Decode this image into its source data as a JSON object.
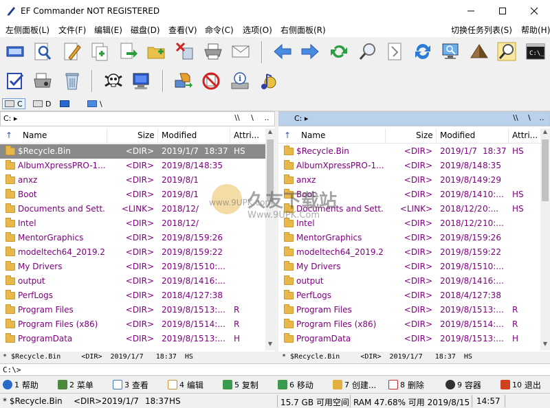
{
  "window": {
    "title": "EF Commander NOT REGISTERED"
  },
  "menu": [
    "左侧面板(L)",
    "文件(F)",
    "编辑(E)",
    "磁盘(D)",
    "查看(V)",
    "命令(C)",
    "选项(O)",
    "右侧面板(R)",
    "切换任务列表(S)",
    "帮助(H)"
  ],
  "toolbar_icons": [
    "drive-icon",
    "find-icon",
    "edit-icon",
    "copy-icon",
    "move-icon",
    "newfolder-icon",
    "delete-icon",
    "print-icon",
    "email-icon",
    "back-icon",
    "forward-icon",
    "refresh-icon",
    "search-icon",
    "compare-icon",
    "sync-icon",
    "monitor-icon",
    "pyramid-icon",
    "zoom-icon",
    "console-icon",
    "select-icon",
    "scanner-icon",
    "recycle-icon",
    "skull-icon",
    "desktop-icon",
    "network-icon",
    "nofile-icon",
    "info-icon",
    "music-icon"
  ],
  "drives": [
    {
      "label": "C"
    },
    {
      "label": "D"
    },
    {
      "label": ""
    },
    {
      "label": "\\"
    }
  ],
  "left": {
    "path": "C: ▸",
    "btn1": "\\\\",
    "btn2": "\\",
    "btn3": "..",
    "headers": {
      "name": "Name",
      "size": "Size",
      "modified": "Modified",
      "attr": "Attri..."
    },
    "rows": [
      {
        "name": "$Recycle.Bin",
        "size": "<DIR>",
        "date": "2019/1/7",
        "time": "18:37",
        "attr": "HS"
      },
      {
        "name": "AlbumXpressPRO-1...",
        "size": "<DIR>",
        "date": "2019/8/14",
        "time": "8:35",
        "attr": ""
      },
      {
        "name": "anxz",
        "size": "<DIR>",
        "date": "2019/8/1",
        "time": "",
        "attr": ""
      },
      {
        "name": "Boot",
        "size": "<DIR>",
        "date": "2019/8/1",
        "time": "",
        "attr": ""
      },
      {
        "name": "Documents and Sett...",
        "size": "<LINK>",
        "date": "2018/12/",
        "time": "",
        "attr": ""
      },
      {
        "name": "Intel",
        "size": "<DIR>",
        "date": "2018/12/",
        "time": "",
        "attr": ""
      },
      {
        "name": "MentorGraphics",
        "size": "<DIR>",
        "date": "2019/8/15",
        "time": "9:26",
        "attr": ""
      },
      {
        "name": "modeltech64_2019.2",
        "size": "<DIR>",
        "date": "2019/8/15",
        "time": "9:22",
        "attr": ""
      },
      {
        "name": "My Drivers",
        "size": "<DIR>",
        "date": "2019/8/15",
        "time": "10:...",
        "attr": ""
      },
      {
        "name": "output",
        "size": "<DIR>",
        "date": "2019/8/14",
        "time": "16:...",
        "attr": ""
      },
      {
        "name": "PerfLogs",
        "size": "<DIR>",
        "date": "2018/4/12",
        "time": "7:38",
        "attr": ""
      },
      {
        "name": "Program Files",
        "size": "<DIR>",
        "date": "2019/8/15",
        "time": "13:...",
        "attr": "R"
      },
      {
        "name": "Program Files (x86)",
        "size": "<DIR>",
        "date": "2019/8/15",
        "time": "14:...",
        "attr": "R"
      },
      {
        "name": "ProgramData",
        "size": "<DIR>",
        "date": "2019/8/15",
        "time": "13:...",
        "attr": "H"
      }
    ],
    "info": "* $Recycle.Bin     <DIR>  2019/1/7   18:37  HS"
  },
  "right": {
    "path": "C: ▸",
    "btn1": "\\\\",
    "btn2": "\\",
    "btn3": "..",
    "headers": {
      "name": "Name",
      "size": "Size",
      "modified": "Modified",
      "attr": "Attri..."
    },
    "rows": [
      {
        "name": "$Recycle.Bin",
        "size": "<DIR>",
        "date": "2019/1/7",
        "time": "18:37",
        "attr": "HS"
      },
      {
        "name": "AlbumXpressPRO-1...",
        "size": "<DIR>",
        "date": "2019/8/14",
        "time": "8:35",
        "attr": ""
      },
      {
        "name": "anxz",
        "size": "<DIR>",
        "date": "2019/8/14",
        "time": "9:29",
        "attr": ""
      },
      {
        "name": "Boot",
        "size": "<DIR>",
        "date": "2019/8/14",
        "time": "10:...",
        "attr": "HS"
      },
      {
        "name": "Documents and Sett...",
        "size": "<LINK>",
        "date": "2018/12/22",
        "time": "0:...",
        "attr": "HS"
      },
      {
        "name": "Intel",
        "size": "<DIR>",
        "date": "2018/12/22",
        "time": "10:...",
        "attr": ""
      },
      {
        "name": "MentorGraphics",
        "size": "<DIR>",
        "date": "2019/8/15",
        "time": "9:26",
        "attr": ""
      },
      {
        "name": "modeltech64_2019.2",
        "size": "<DIR>",
        "date": "2019/8/15",
        "time": "9:22",
        "attr": ""
      },
      {
        "name": "My Drivers",
        "size": "<DIR>",
        "date": "2019/8/15",
        "time": "10:...",
        "attr": ""
      },
      {
        "name": "output",
        "size": "<DIR>",
        "date": "2019/8/14",
        "time": "16:...",
        "attr": ""
      },
      {
        "name": "PerfLogs",
        "size": "<DIR>",
        "date": "2018/4/12",
        "time": "7:38",
        "attr": ""
      },
      {
        "name": "Program Files",
        "size": "<DIR>",
        "date": "2019/8/15",
        "time": "13:...",
        "attr": "R"
      },
      {
        "name": "Program Files (x86)",
        "size": "<DIR>",
        "date": "2019/8/15",
        "time": "14:...",
        "attr": "R"
      },
      {
        "name": "ProgramData",
        "size": "<DIR>",
        "date": "2019/8/15",
        "time": "13:...",
        "attr": "H"
      }
    ],
    "info": "* $Recycle.Bin     <DIR>  2019/1/7   18:37  HS"
  },
  "cmdline": "C:\\>",
  "fkeys": [
    {
      "num": "1",
      "label": "帮助",
      "color": "#2a6ac8"
    },
    {
      "num": "2",
      "label": "菜单",
      "color": "#4a8a3a"
    },
    {
      "num": "3",
      "label": "查看",
      "color": "#3a78c0"
    },
    {
      "num": "4",
      "label": "编辑",
      "color": "#d09030"
    },
    {
      "num": "5",
      "label": "复制",
      "color": "#3a9a4a"
    },
    {
      "num": "6",
      "label": "移动",
      "color": "#3a9a4a"
    },
    {
      "num": "7",
      "label": "创建...",
      "color": "#e0b040"
    },
    {
      "num": "8",
      "label": "删除",
      "color": "#c03030"
    },
    {
      "num": "9",
      "label": "容器",
      "color": "#303030"
    },
    {
      "num": "10",
      "label": "退出",
      "color": "#d04020"
    }
  ],
  "status": {
    "file": "* $Recycle.Bin",
    "type": "<DIR>",
    "date": "2019/1/7",
    "time": "18:37",
    "attr": "HS",
    "free": "15.7 GB 可用空间",
    "ram": "RAM 47.68% 可用 2019/8/15",
    "clock": "14:57"
  },
  "watermark": {
    "cn": "久友下载站",
    "url1": "www.9UPK.com",
    "url2": "Www.9UPK.Com"
  }
}
